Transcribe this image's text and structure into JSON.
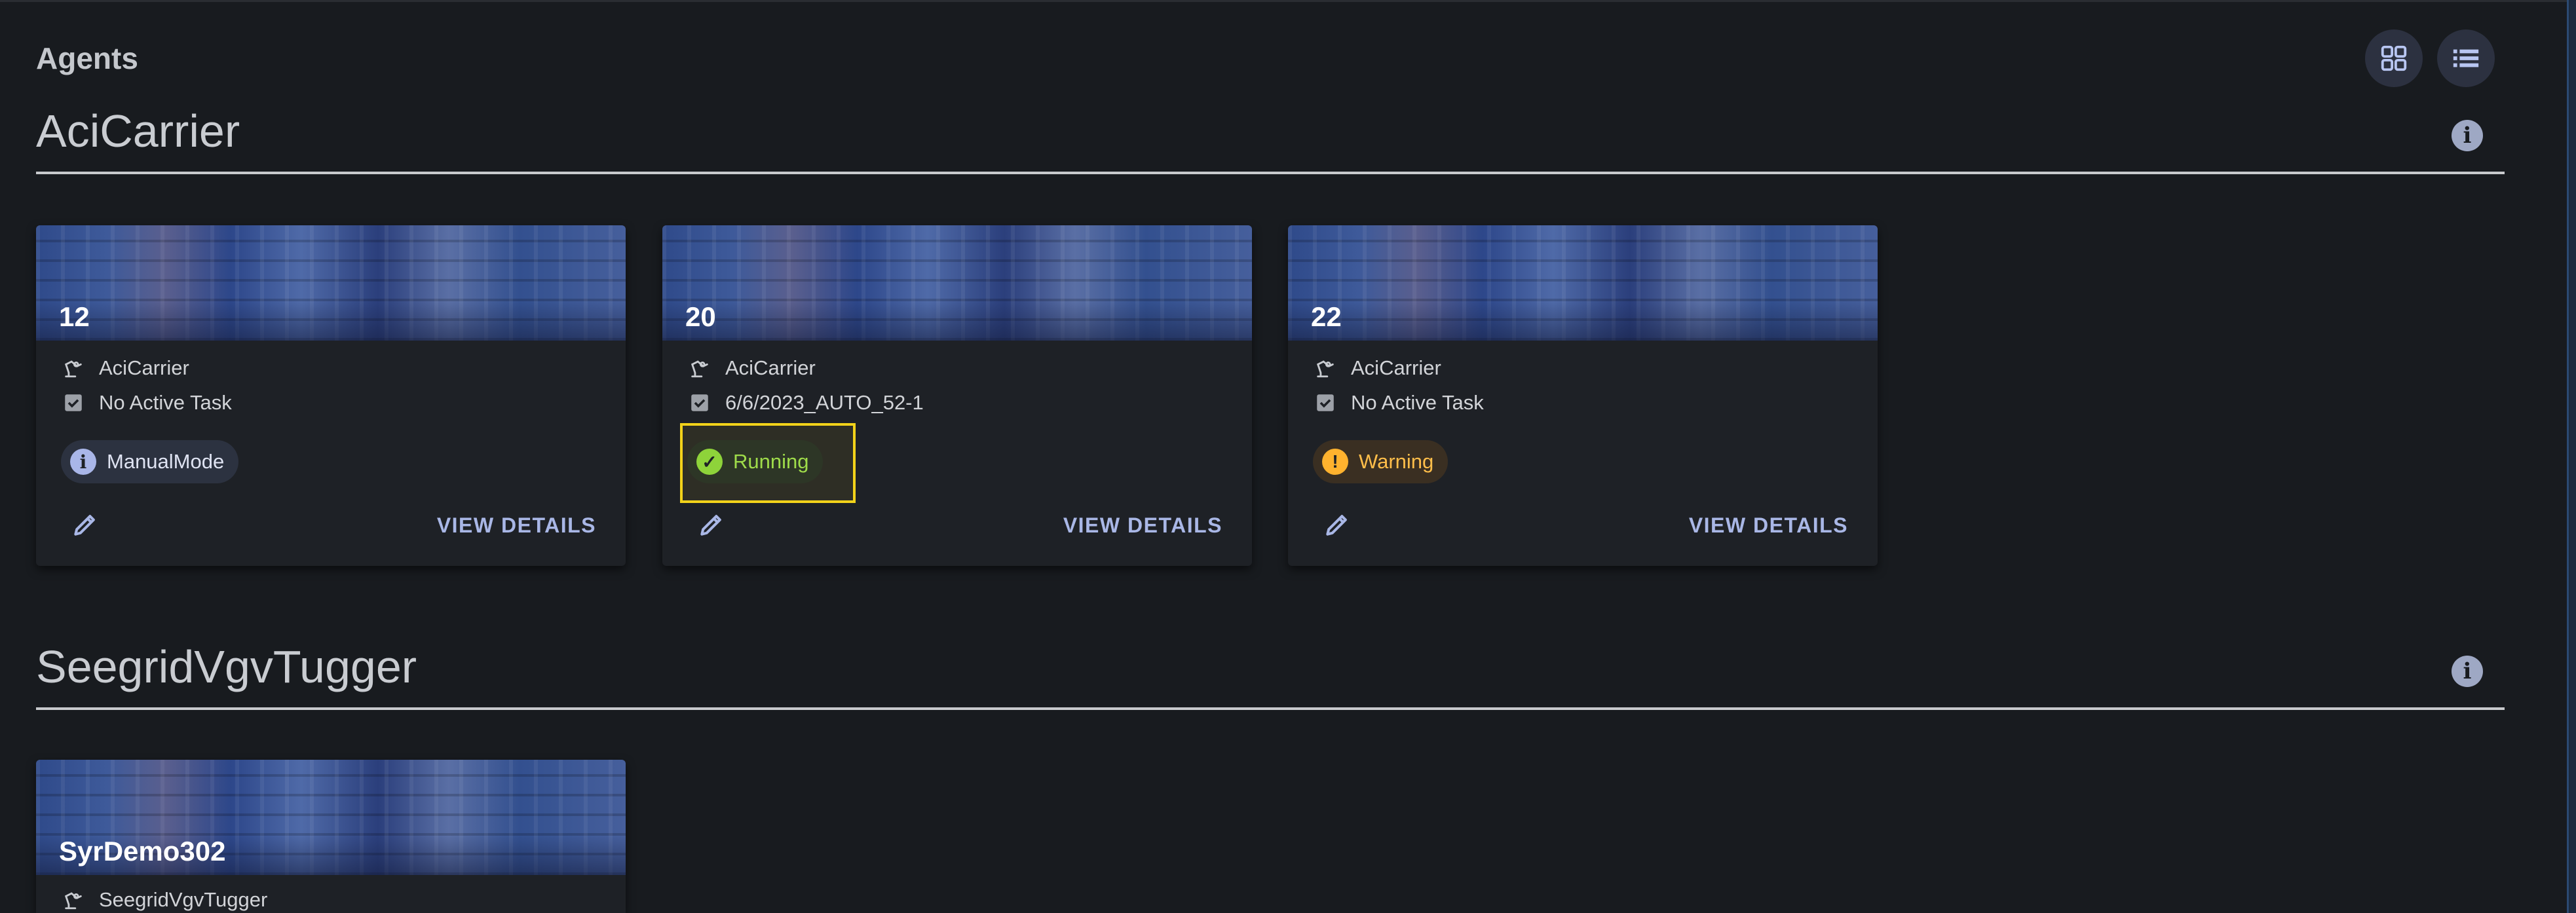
{
  "header": {
    "title": "Agents"
  },
  "toolbar": {
    "grid_view_icon": "grid-view-icon",
    "list_view_icon": "list-view-icon"
  },
  "groups": [
    {
      "title": "AciCarrier",
      "info_icon_glyph": "i",
      "agents": [
        {
          "name": "12",
          "type": "AciCarrier",
          "task": "No Active Task",
          "status": "ManualMode",
          "status_kind": "info",
          "status_glyph": "i",
          "action_label": "VIEW DETAILS"
        },
        {
          "name": "20",
          "type": "AciCarrier",
          "task": "6/6/2023_AUTO_52-1",
          "status": "Running",
          "status_kind": "running",
          "status_glyph": "✓",
          "action_label": "VIEW DETAILS",
          "highlighted": true
        },
        {
          "name": "22",
          "type": "AciCarrier",
          "task": "No Active Task",
          "status": "Warning",
          "status_kind": "warning",
          "status_glyph": "!",
          "action_label": "VIEW DETAILS"
        }
      ]
    },
    {
      "title": "SeegridVgvTugger",
      "info_icon_glyph": "i",
      "agents": [
        {
          "name": "SyrDemo302",
          "type": "SeegridVgvTugger"
        }
      ]
    }
  ],
  "colors": {
    "background": "#181b1f",
    "card": "#1e2126",
    "accent": "#a9b7e6",
    "running": "#8ed33a",
    "warning": "#ffb22e",
    "highlight": "#f2d21a"
  }
}
